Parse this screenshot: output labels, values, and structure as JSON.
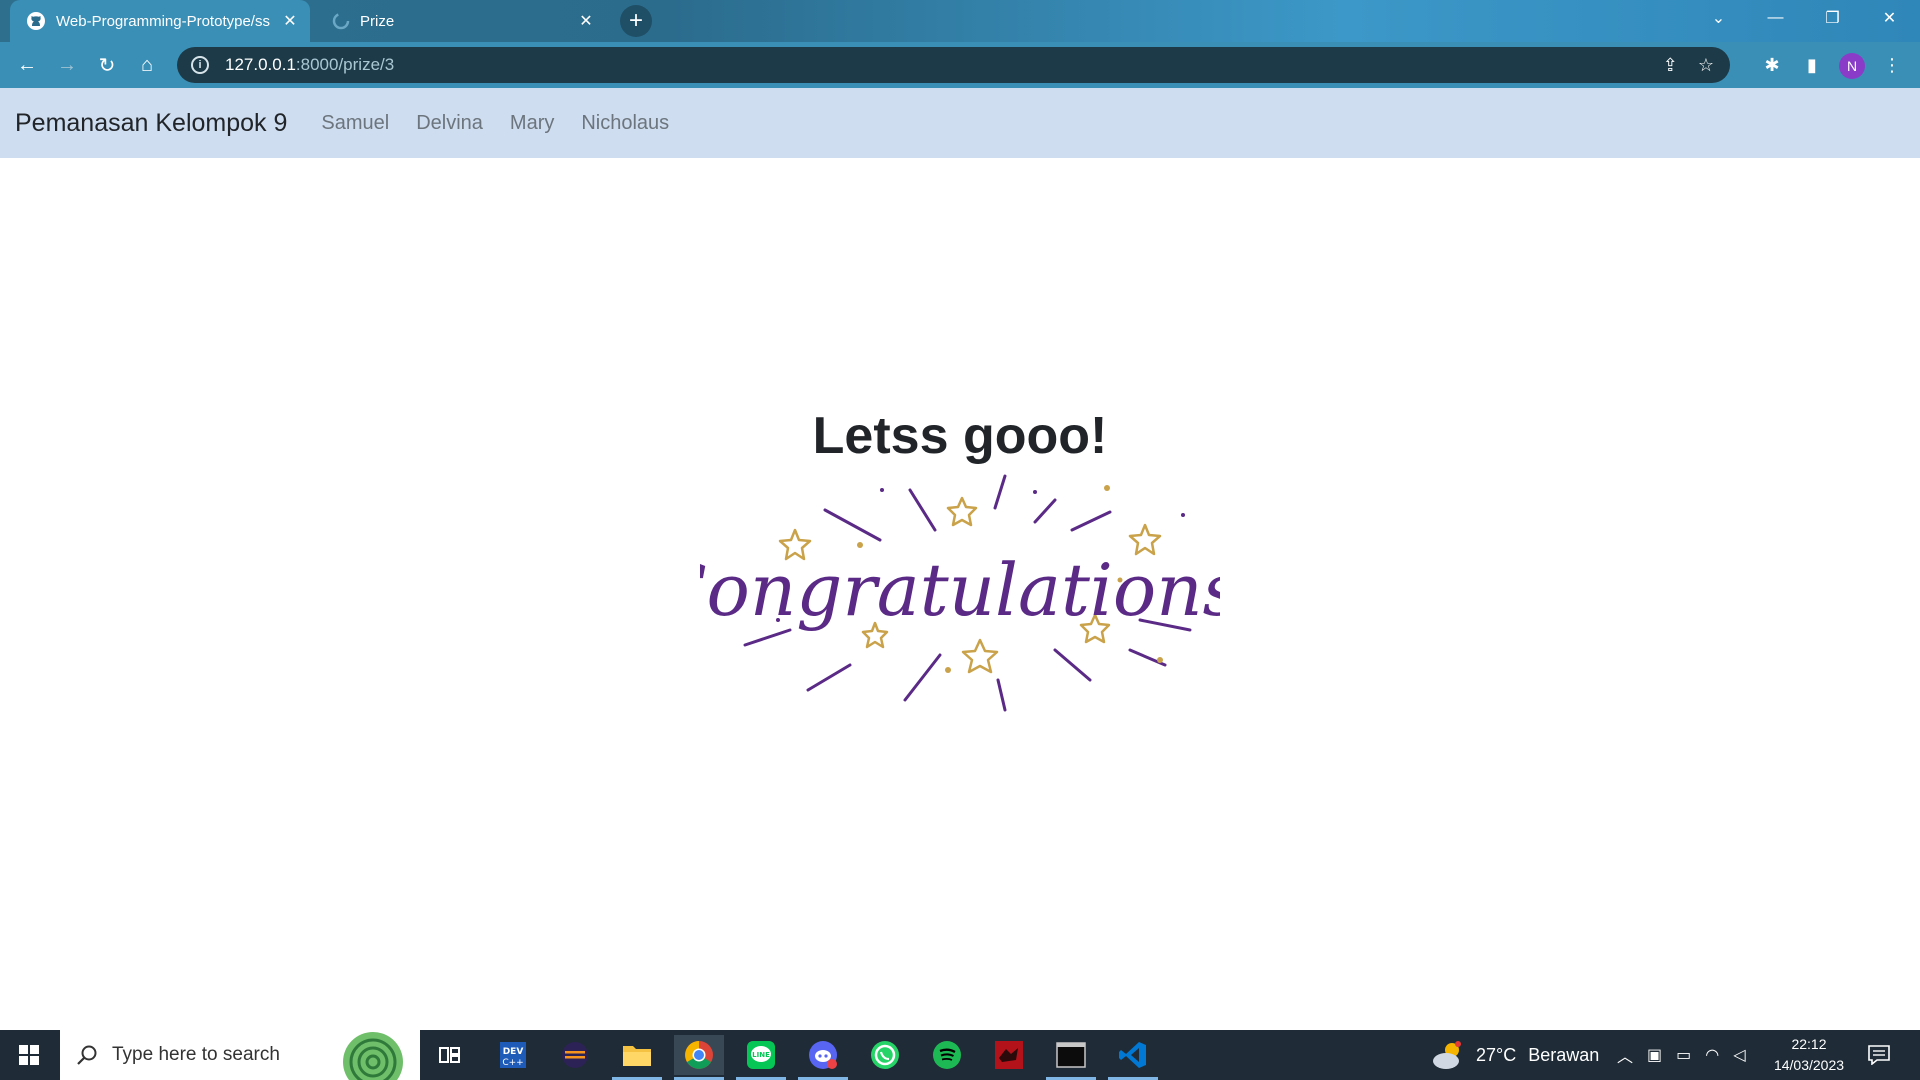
{
  "browser": {
    "tabs": [
      {
        "title": "Web-Programming-Prototype/ss"
      },
      {
        "title": "Prize"
      }
    ],
    "url_host": "127.0.0.1",
    "url_path": ":8000/prize/3",
    "profile_initial": "N"
  },
  "navbar": {
    "brand": "Pemanasan Kelompok 9",
    "links": [
      "Samuel",
      "Delvina",
      "Mary",
      "Nicholaus"
    ]
  },
  "page": {
    "heading": "Letss gooo!",
    "image_text": "Congratulations!"
  },
  "taskbar": {
    "search_placeholder": "Type here to search",
    "weather_temp": "27°C",
    "weather_text": "Berawan",
    "time": "22:12",
    "date": "14/03/2023"
  },
  "colors": {
    "congrats_purple": "#5a2a86",
    "star_gold": "#c9a24a",
    "navbar_bg": "#cfddf0"
  }
}
